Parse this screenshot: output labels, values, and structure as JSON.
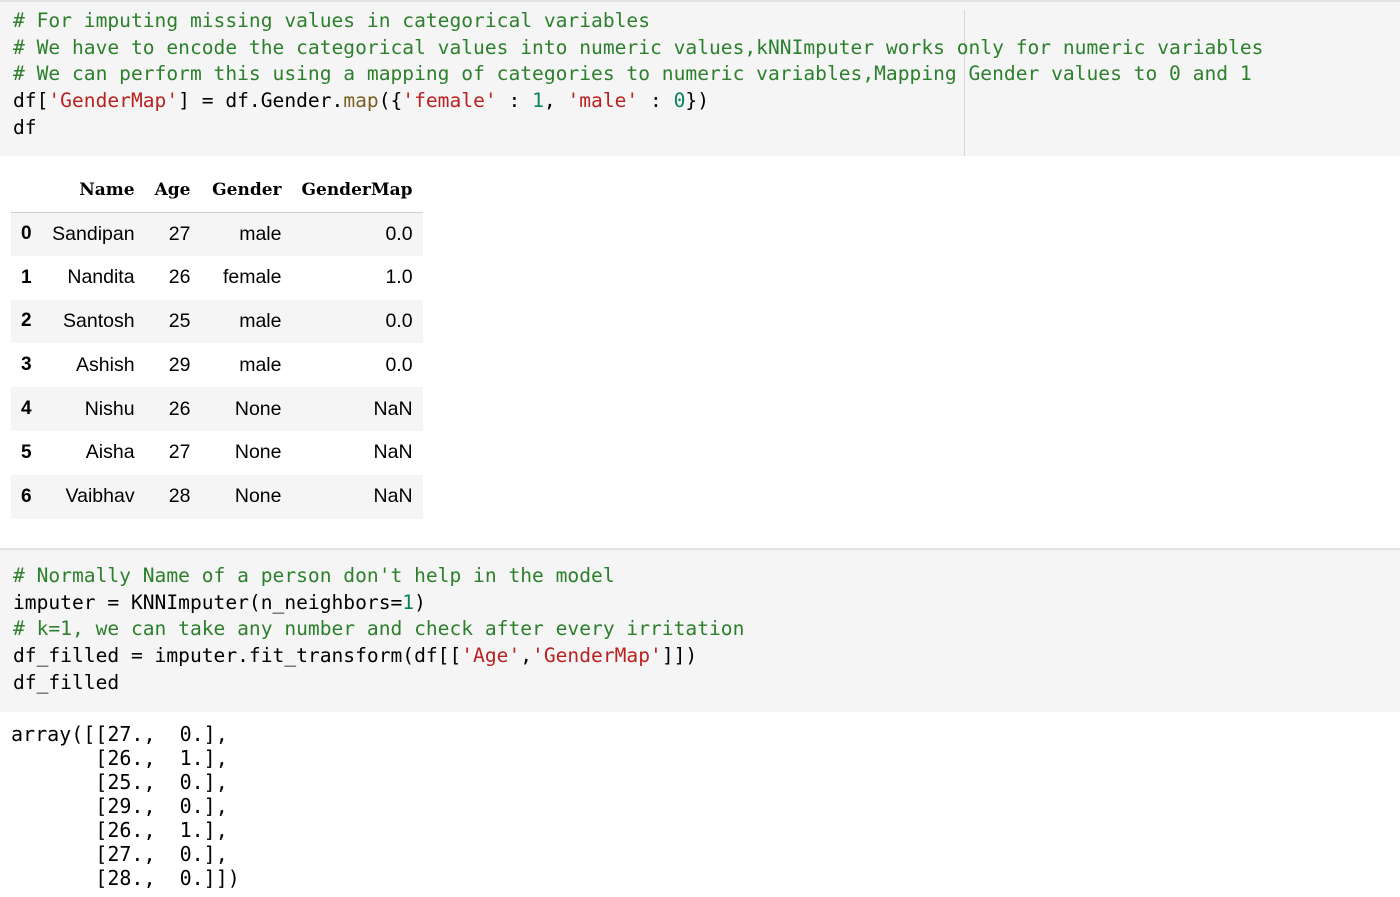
{
  "cell1": {
    "lines": [
      [
        {
          "t": "# For imputing missing values in categorical variables",
          "k": "c"
        }
      ],
      [
        {
          "t": "# We have to encode the categorical values into numeric values,kNNImputer works only for numeric variables",
          "k": "c"
        }
      ],
      [
        {
          "t": "# We can perform this using a mapping of categories to numeric variables,Mapping Gender values to 0 and 1",
          "k": "c"
        }
      ],
      [
        {
          "t": "df[",
          "k": ""
        },
        {
          "t": "'GenderMap'",
          "k": "s"
        },
        {
          "t": "] = df.Gender.",
          "k": ""
        },
        {
          "t": "map",
          "k": "f"
        },
        {
          "t": "({",
          "k": ""
        },
        {
          "t": "'female'",
          "k": "s"
        },
        {
          "t": " : ",
          "k": ""
        },
        {
          "t": "1",
          "k": "n"
        },
        {
          "t": ", ",
          "k": ""
        },
        {
          "t": "'male'",
          "k": "s"
        },
        {
          "t": " : ",
          "k": ""
        },
        {
          "t": "0",
          "k": "n"
        },
        {
          "t": "})",
          "k": ""
        }
      ],
      [
        {
          "t": "df",
          "k": ""
        }
      ]
    ]
  },
  "dataframe": {
    "columns": [
      "",
      "Name",
      "Age",
      "Gender",
      "GenderMap"
    ],
    "rows": [
      {
        "index": "0",
        "name": "Sandipan",
        "age": "27",
        "gender": "male",
        "gendermap": "0.0"
      },
      {
        "index": "1",
        "name": "Nandita",
        "age": "26",
        "gender": "female",
        "gendermap": "1.0"
      },
      {
        "index": "2",
        "name": "Santosh",
        "age": "25",
        "gender": "male",
        "gendermap": "0.0"
      },
      {
        "index": "3",
        "name": "Ashish",
        "age": "29",
        "gender": "male",
        "gendermap": "0.0"
      },
      {
        "index": "4",
        "name": "Nishu",
        "age": "26",
        "gender": "None",
        "gendermap": "NaN"
      },
      {
        "index": "5",
        "name": "Aisha",
        "age": "27",
        "gender": "None",
        "gendermap": "NaN"
      },
      {
        "index": "6",
        "name": "Vaibhav",
        "age": "28",
        "gender": "None",
        "gendermap": "NaN"
      }
    ]
  },
  "cell2": {
    "lines": [
      [
        {
          "t": "# Normally Name of a person don't help in the model",
          "k": "c"
        }
      ],
      [
        {
          "t": "imputer = KNNImputer(n_neighbors=",
          "k": ""
        },
        {
          "t": "1",
          "k": "n"
        },
        {
          "t": ")",
          "k": ""
        }
      ],
      [
        {
          "t": "# k=1, we can take any number and check after every irritation",
          "k": "c"
        }
      ],
      [
        {
          "t": "df_filled = imputer.fit_transform(df[[",
          "k": ""
        },
        {
          "t": "'Age'",
          "k": "s"
        },
        {
          "t": ",",
          "k": ""
        },
        {
          "t": "'GenderMap'",
          "k": "s"
        },
        {
          "t": "]])",
          "k": ""
        }
      ],
      [
        {
          "t": "df_filled",
          "k": ""
        }
      ]
    ]
  },
  "output2": {
    "lines": [
      "array([[27.,  0.],",
      "       [26.,  1.],",
      "       [25.,  0.],",
      "       [29.,  0.],",
      "       [26.,  1.],",
      "       [27.,  0.],",
      "       [28.,  0.]])"
    ]
  },
  "colors": {
    "comment": "#2c7f2c",
    "string": "#ba2121",
    "number": "#098658",
    "function": "#795e26",
    "cell_background": "#f5f5f5"
  }
}
